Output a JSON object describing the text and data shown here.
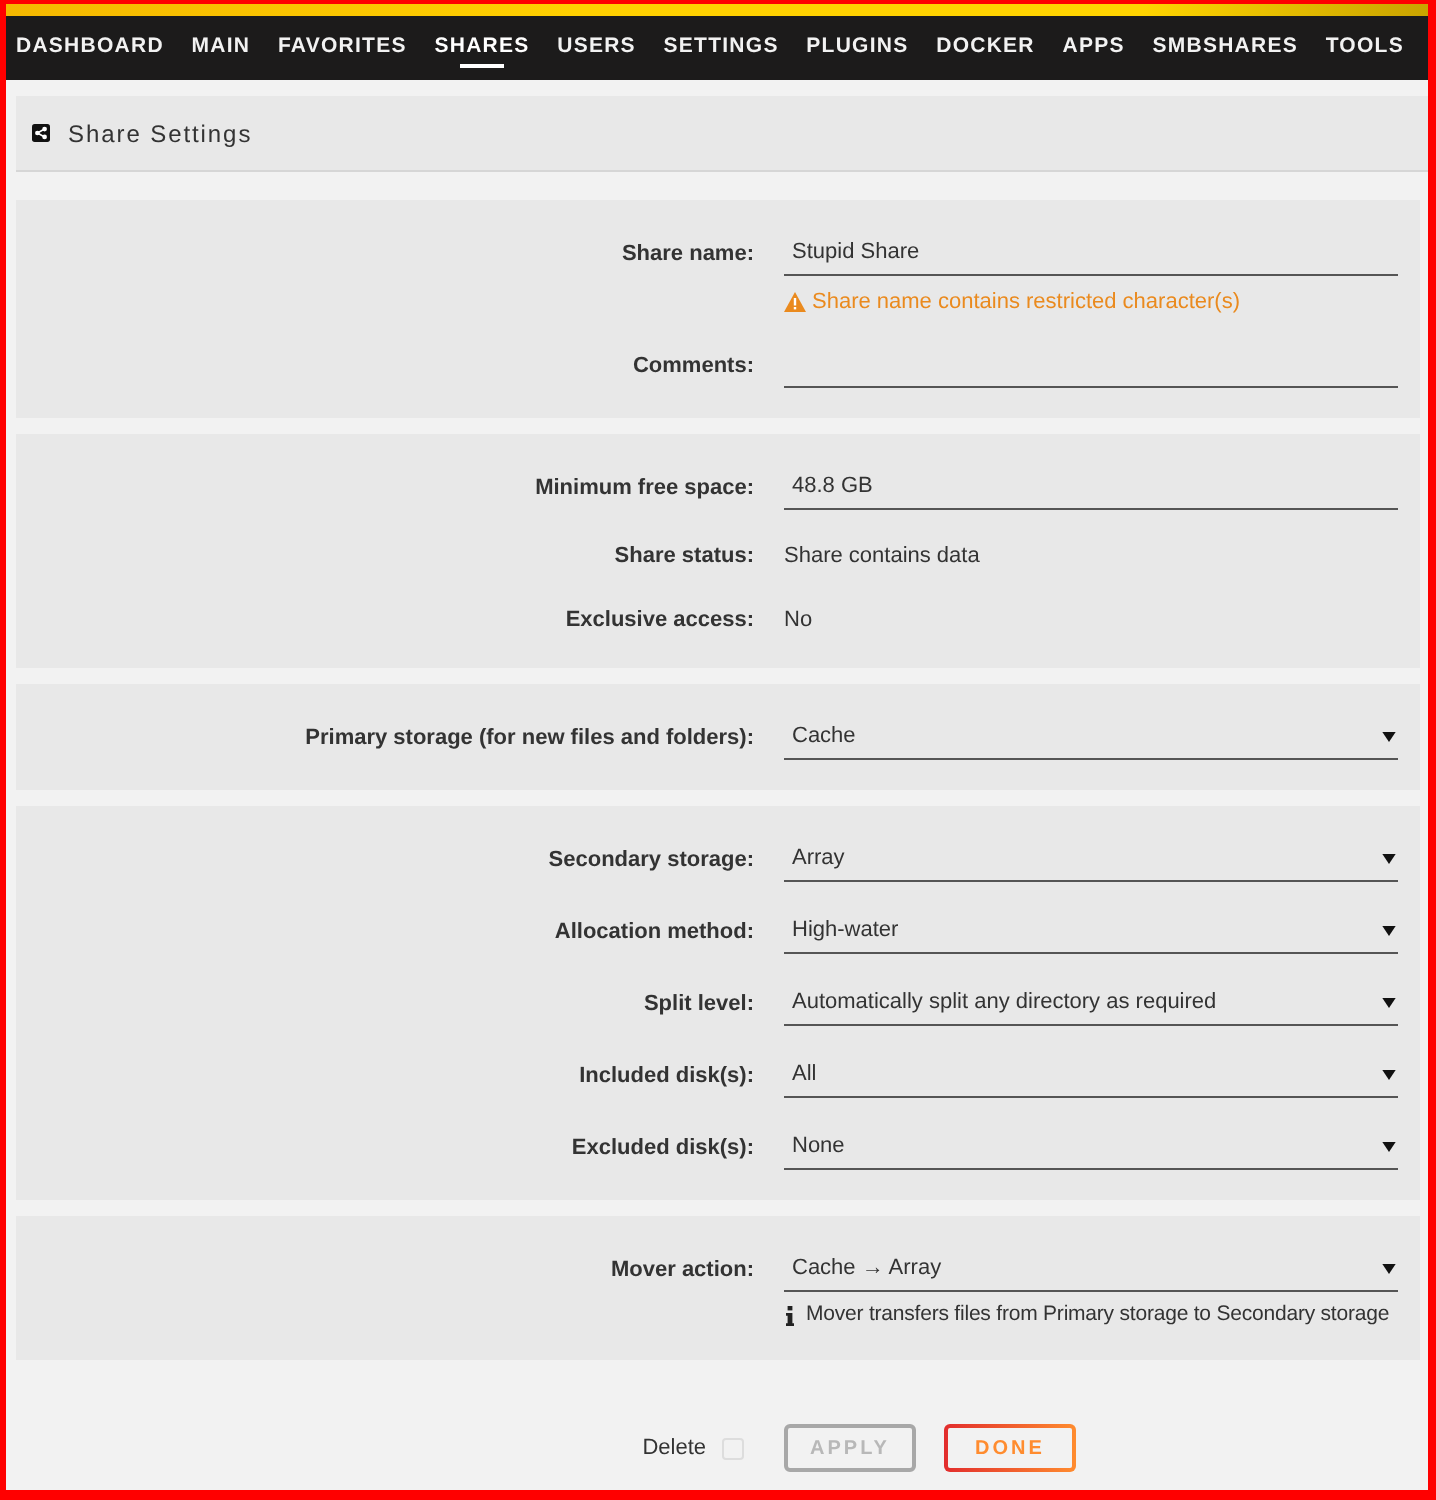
{
  "nav": {
    "items": [
      {
        "label": "DASHBOARD",
        "selected": false
      },
      {
        "label": "MAIN",
        "selected": false
      },
      {
        "label": "FAVORITES",
        "selected": false
      },
      {
        "label": "SHARES",
        "selected": true
      },
      {
        "label": "USERS",
        "selected": false
      },
      {
        "label": "SETTINGS",
        "selected": false
      },
      {
        "label": "PLUGINS",
        "selected": false
      },
      {
        "label": "DOCKER",
        "selected": false
      },
      {
        "label": "APPS",
        "selected": false
      },
      {
        "label": "SMBSHARES",
        "selected": false
      },
      {
        "label": "TOOLS",
        "selected": false
      }
    ]
  },
  "page_title": {
    "text": "Share Settings"
  },
  "sections": [
    {
      "rows": [
        {
          "kind": "input",
          "label": "Share name:",
          "value": "Stupid Share",
          "warning": "Share name contains restricted character(s)"
        },
        {
          "kind": "input",
          "label": "Comments:"
        }
      ]
    },
    {
      "rows": [
        {
          "kind": "input",
          "label": "Minimum free space:",
          "value": "48.8 GB"
        },
        {
          "kind": "text",
          "label": "Share status:",
          "value": "Share contains data"
        },
        {
          "kind": "text",
          "label": "Exclusive access:",
          "value": "No"
        }
      ]
    },
    {
      "rows": [
        {
          "kind": "select",
          "label": "Primary storage (for new files and folders):",
          "value": "Cache"
        }
      ]
    },
    {
      "rows": [
        {
          "kind": "select",
          "label": "Secondary storage:",
          "value": "Array"
        },
        {
          "kind": "select",
          "label": "Allocation method:",
          "value": "High-water"
        },
        {
          "kind": "select",
          "label": "Split level:",
          "value": "Automatically split any directory as required"
        },
        {
          "kind": "select",
          "label": "Included disk(s):",
          "value": "All"
        },
        {
          "kind": "select",
          "label": "Excluded disk(s):",
          "value": "None"
        }
      ]
    },
    {
      "rows": [
        {
          "kind": "select",
          "label": "Mover action:",
          "value": "Cache → Array",
          "info": "Mover transfers files from Primary storage to Secondary storage"
        }
      ]
    }
  ],
  "footer": {
    "delete": {
      "label": "Delete",
      "checked": false
    },
    "buttons": [
      {
        "label": "APPLY",
        "disabled": true
      },
      {
        "label": "DONE",
        "disabled": false
      }
    ]
  }
}
